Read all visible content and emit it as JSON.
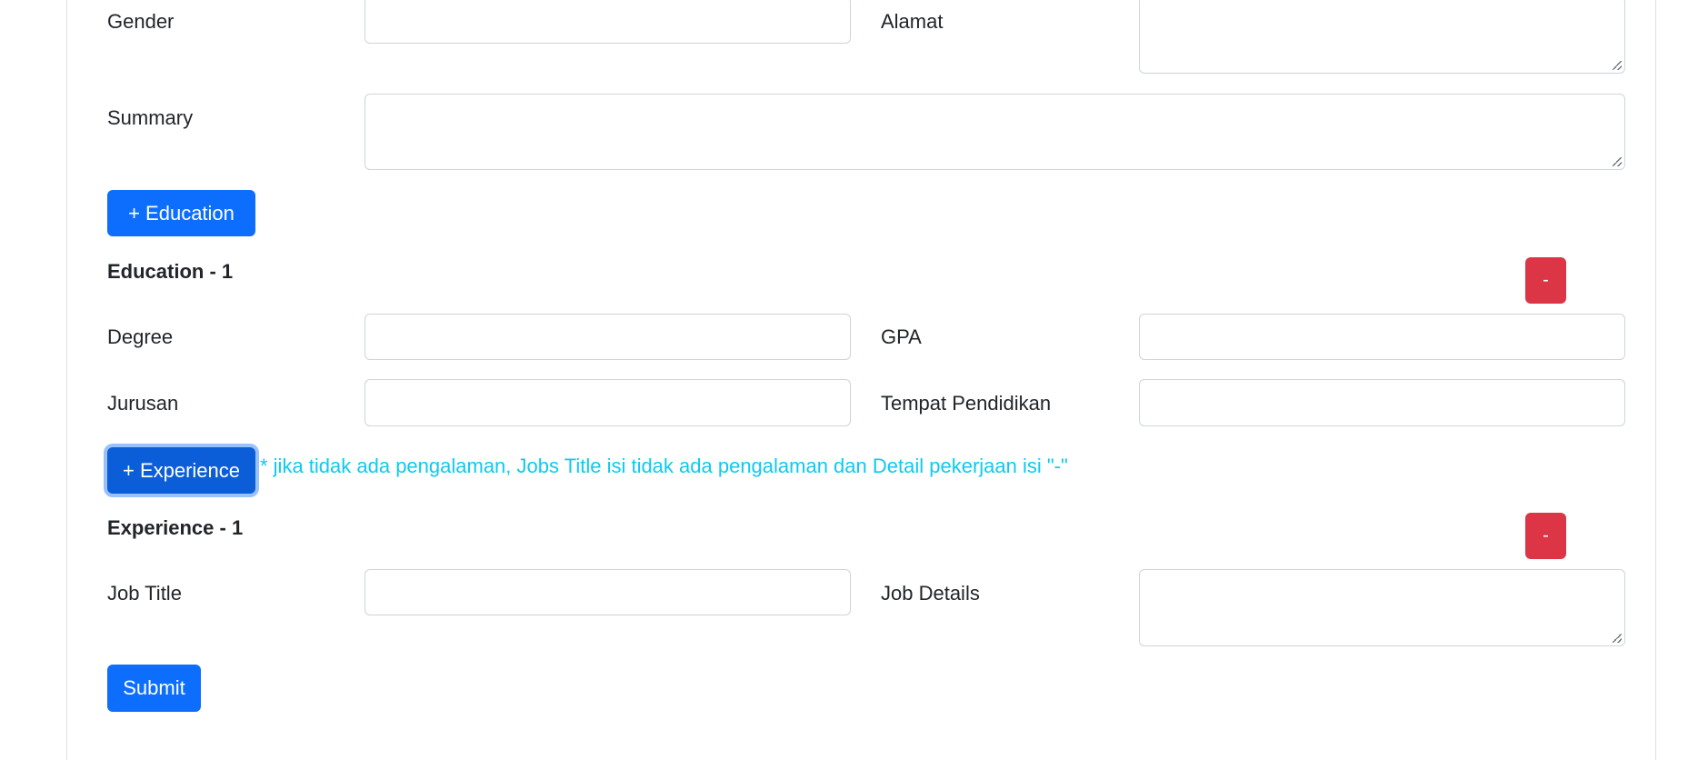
{
  "form": {
    "personal": {
      "gender_label": "Gender",
      "alamat_label": "Alamat",
      "summary_label": "Summary"
    },
    "add_education_label": "+ Education",
    "education_sections": [
      {
        "title": "Education - 1",
        "remove_label": "-",
        "degree_label": "Degree",
        "gpa_label": "GPA",
        "jurusan_label": "Jurusan",
        "tempat_label": "Tempat Pendidikan"
      }
    ],
    "add_experience_label": "+ Experience",
    "experience_hint": "* jika tidak ada pengalaman, Jobs Title isi tidak ada pengalaman dan Detail pekerjaan isi \"-\"",
    "experience_sections": [
      {
        "title": "Experience - 1",
        "remove_label": "-",
        "job_title_label": "Job Title",
        "job_details_label": "Job Details"
      }
    ],
    "submit_label": "Submit"
  },
  "colors": {
    "primary": "#0d6efd",
    "danger": "#dc3545",
    "info": "#0dcaf0",
    "border": "#ced4da"
  }
}
